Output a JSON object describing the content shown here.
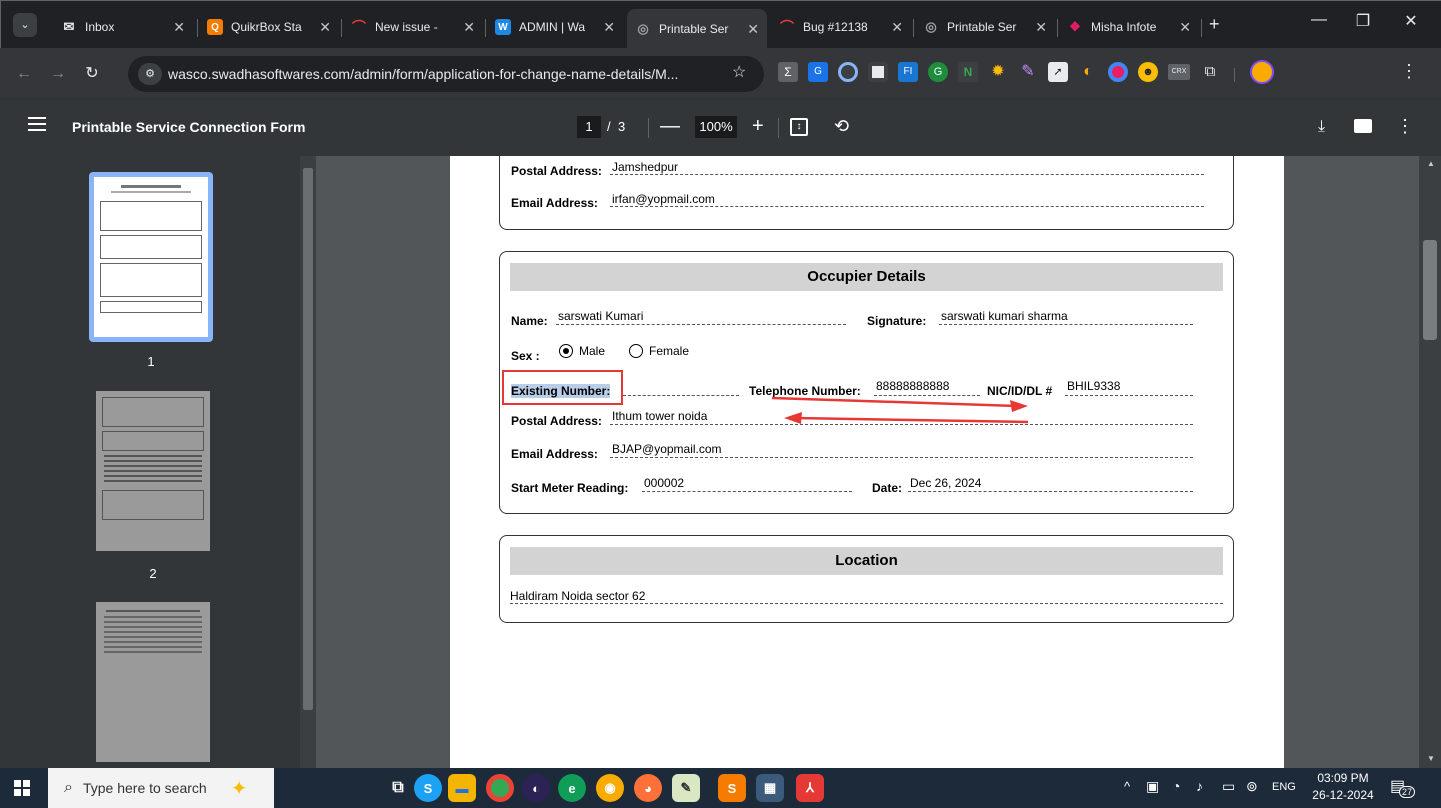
{
  "browser": {
    "tabs": [
      {
        "title": "Inbox",
        "icon": "mail-icon",
        "color": "#ea4335"
      },
      {
        "title": "QuikrBox Sta",
        "icon": "quikrbox-icon",
        "color": "#f57c00"
      },
      {
        "title": "New issue -",
        "icon": "issue-icon",
        "color": "#e53935"
      },
      {
        "title": "ADMIN | Wa",
        "icon": "admin-icon",
        "color": "#1e88e5"
      },
      {
        "title": "Printable Ser",
        "icon": "globe-icon",
        "color": "#9aa0a6",
        "active": true
      },
      {
        "title": "Bug #12138",
        "icon": "bug-icon",
        "color": "#e53935"
      },
      {
        "title": "Printable Ser",
        "icon": "globe-icon",
        "color": "#9aa0a6"
      },
      {
        "title": "Misha Infote",
        "icon": "misha-icon",
        "color": "#e91e63"
      }
    ],
    "url": "wasco.swadhasoftwares.com/admin/form/application-for-change-name-details/M..."
  },
  "pdf": {
    "title": "Printable Service Connection Form",
    "current_page": "1",
    "page_sep": "/",
    "total_pages": "3",
    "zoom": "100%",
    "thumbnails": [
      "1",
      "2"
    ]
  },
  "form": {
    "owner": {
      "postal_label": "Postal Address:",
      "postal_value": "Jamshedpur",
      "email_label": "Email Address:",
      "email_value": "irfan@yopmail.com"
    },
    "occupier": {
      "heading": "Occupier Details",
      "name_label": "Name:",
      "name_value": "sarswati Kumari",
      "signature_label": "Signature:",
      "signature_value": "sarswati kumari sharma",
      "sex_label": "Sex :",
      "sex_male": "Male",
      "sex_female": "Female",
      "existing_label": "Existing Number:",
      "telephone_label": "Telephone Number:",
      "telephone_value": "88888888888",
      "nic_label": "NIC/ID/DL #",
      "nic_value": "BHIL9338",
      "postal_label": "Postal Address:",
      "postal_value": "Ithum tower noida",
      "email_label": "Email Address:",
      "email_value": "BJAP@yopmail.com",
      "meter_label": "Start Meter Reading:",
      "meter_value": "000002",
      "date_label": "Date:",
      "date_value": "Dec 26, 2024"
    },
    "location": {
      "heading": "Location",
      "value": "Haldiram Noida sector 62"
    }
  },
  "taskbar": {
    "search_placeholder": "Type here to search",
    "lang": "ENG",
    "time": "03:09 PM",
    "date": "26-12-2024",
    "notif_count": "27"
  },
  "colors": {
    "annotation_red": "#e53935",
    "chrome_dark": "#202124",
    "pdf_bg": "#525659"
  }
}
